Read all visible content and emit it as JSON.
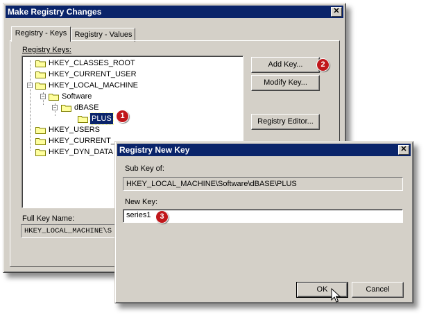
{
  "main_dialog": {
    "title": "Make Registry Changes",
    "tabs": [
      "Registry - Keys",
      "Registry - Values"
    ],
    "tree_label": "Registry Keys:",
    "tree": [
      {
        "label": "HKEY_CLASSES_ROOT"
      },
      {
        "label": "HKEY_CURRENT_USER"
      },
      {
        "label": "HKEY_LOCAL_MACHINE"
      },
      {
        "label": "Software"
      },
      {
        "label": "dBASE"
      },
      {
        "label": "PLUS"
      },
      {
        "label": "HKEY_USERS"
      },
      {
        "label": "HKEY_CURRENT_"
      },
      {
        "label": "HKEY_DYN_DATA"
      }
    ],
    "full_key_label": "Full Key Name:",
    "full_key_value": "HKEY_LOCAL_MACHINE\\S",
    "buttons": {
      "add_key": "Add Key...",
      "modify_key": "Modify Key...",
      "registry_editor": "Registry Editor..."
    }
  },
  "new_key_dialog": {
    "title": "Registry New Key",
    "subkey_label": "Sub Key of:",
    "subkey_value": "HKEY_LOCAL_MACHINE\\Software\\dBASE\\PLUS",
    "newkey_label": "New Key:",
    "newkey_value": "series1",
    "ok": "OK",
    "cancel": "Cancel"
  },
  "callouts": [
    "1",
    "2",
    "3"
  ],
  "colors": {
    "titlebar": "#0a246a",
    "face": "#d4d0c8",
    "callout": "#c0171b",
    "selection": "#0a246a"
  }
}
